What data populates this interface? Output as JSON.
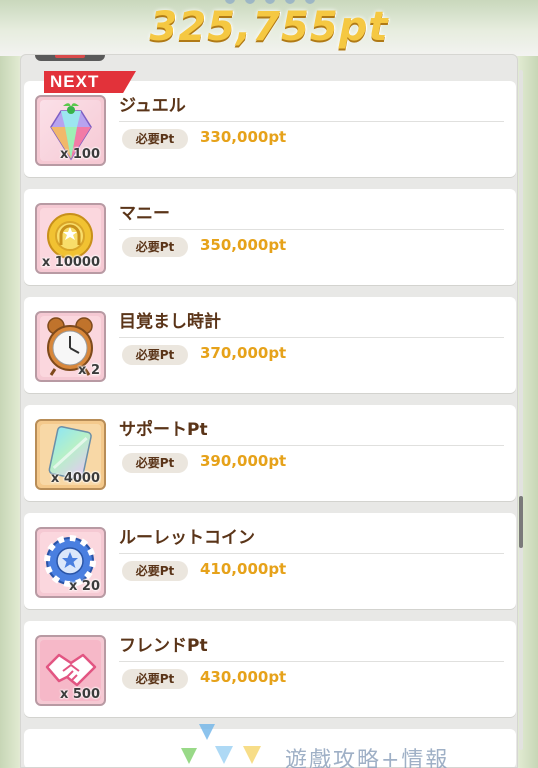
{
  "header": {
    "total_points": "325,755pt"
  },
  "next_label": "NEXT",
  "required_label": "必要Pt",
  "rewards": [
    {
      "name": "ジュエル",
      "quantity": "x 100",
      "required": "330,000pt",
      "icon": "jewel-icon"
    },
    {
      "name": "マニー",
      "quantity": "x 10000",
      "required": "350,000pt",
      "icon": "coin-icon"
    },
    {
      "name": "目覚まし時計",
      "quantity": "x 2",
      "required": "370,000pt",
      "icon": "alarm-clock-icon"
    },
    {
      "name": "サポートPt",
      "quantity": "x 4000",
      "required": "390,000pt",
      "icon": "support-card-icon"
    },
    {
      "name": "ルーレットコイン",
      "quantity": "x 20",
      "required": "410,000pt",
      "icon": "roulette-coin-icon"
    },
    {
      "name": "フレンドPt",
      "quantity": "x 500",
      "required": "430,000pt",
      "icon": "handshake-icon"
    }
  ],
  "watermark": {
    "text": "遊戲攻略+情報"
  },
  "colors": {
    "accent_gold": "#e6a21a",
    "name_brown": "#5a3418",
    "next_red": "#e2323a",
    "icon_bg_pink": "#f5c9d3"
  }
}
